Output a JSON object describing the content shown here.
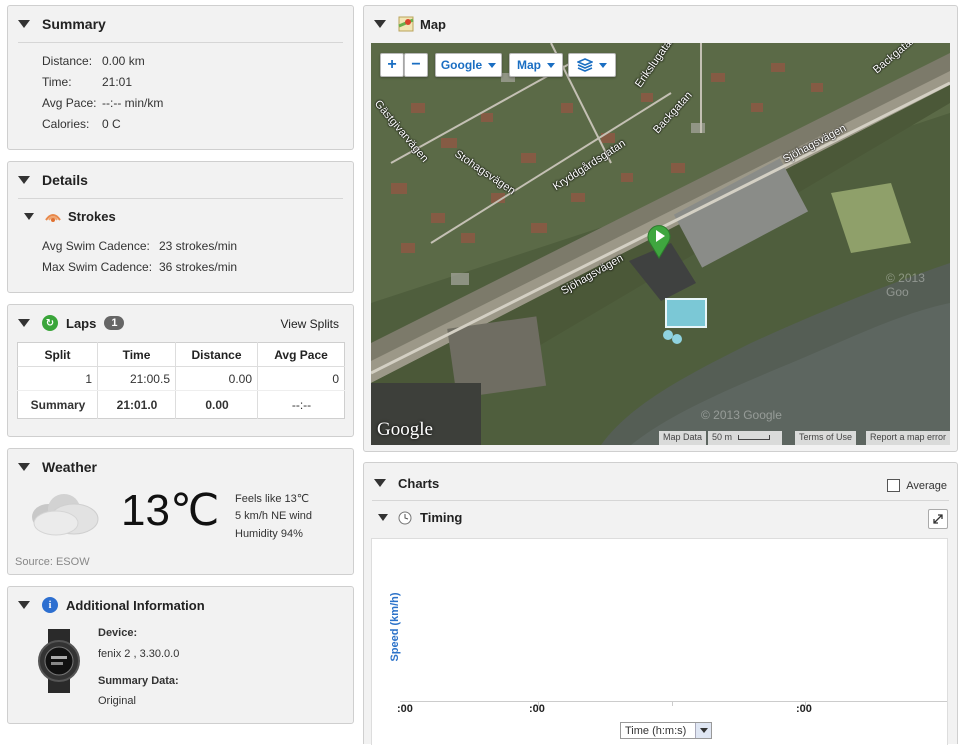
{
  "summary": {
    "title": "Summary",
    "rows": [
      {
        "label": "Distance:",
        "value": "0.00 km"
      },
      {
        "label": "Time:",
        "value": "21:01"
      },
      {
        "label": "Avg Pace:",
        "value": "--:-- min/km"
      },
      {
        "label": "Calories:",
        "value": "0 C"
      }
    ]
  },
  "details": {
    "title": "Details",
    "section": "Strokes",
    "rows": [
      {
        "label": "Avg Swim Cadence:",
        "value": "23 strokes/min"
      },
      {
        "label": "Max Swim Cadence:",
        "value": "36 strokes/min"
      }
    ]
  },
  "laps": {
    "title": "Laps",
    "count": "1",
    "view_splits": "View Splits",
    "headers": [
      "Split",
      "Time",
      "Distance",
      "Avg Pace"
    ],
    "rows": [
      {
        "split": "1",
        "time": "21:00.5",
        "distance": "0.00",
        "pace": "0"
      }
    ],
    "summary": {
      "split": "Summary",
      "time": "21:01.0",
      "distance": "0.00",
      "pace": "--:--"
    }
  },
  "weather": {
    "title": "Weather",
    "temp": "13℃",
    "feels": "Feels like 13℃",
    "wind": "5 km/h NE wind",
    "humidity": "Humidity 94%",
    "source": "Source: ESOW"
  },
  "info": {
    "title": "Additional Information",
    "device_label": "Device:",
    "device_value": "fenix 2 , 3.30.0.0",
    "summary_label": "Summary Data:",
    "summary_value": "Original"
  },
  "map": {
    "title": "Map",
    "zoom_in": "+",
    "zoom_out": "−",
    "provider": "Google",
    "type": "Map",
    "logo": "Google",
    "watermarks": [
      "© 2013 Goo",
      "© 2013 Google"
    ],
    "streets": [
      "Gästgivarvägen",
      "Stohagsvägen",
      "Kryddgårdsgatan",
      "Backgatan",
      "Sjöhagsvägen",
      "Sjöhagsvägen",
      "Erikslugatan",
      "Backgatan"
    ],
    "attribution": {
      "data": "Map Data",
      "scale": "50 m",
      "terms": "Terms of Use",
      "report": "Report a map error"
    }
  },
  "charts": {
    "title": "Charts",
    "average": "Average",
    "timing": "Timing",
    "ylabel": "Speed (km/h)",
    "xticks": [
      ":00",
      ":00",
      ":00"
    ],
    "xselect": "Time (h:m:s)"
  },
  "colors": {
    "accent": "#1a6ec2",
    "panel": "#f2f2f2",
    "border": "#cfcfcf",
    "green": "#3aa53a"
  }
}
